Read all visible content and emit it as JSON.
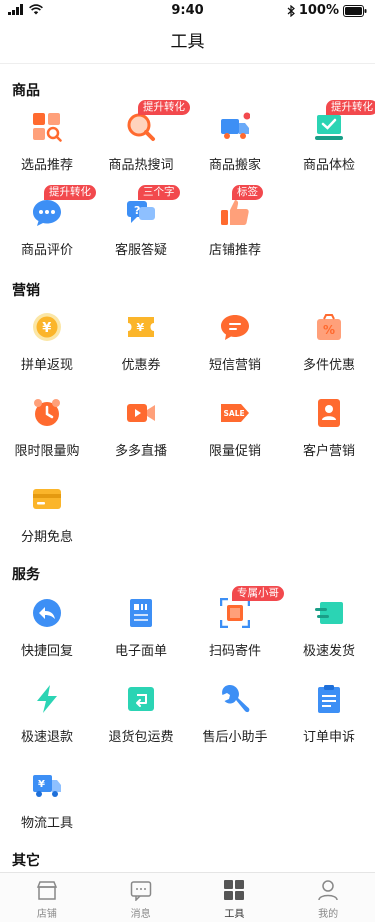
{
  "status_bar": {
    "time": "9:40",
    "battery": "100%"
  },
  "nav": {
    "title": "工具"
  },
  "sections": {
    "goods": {
      "title": "商品",
      "items": [
        {
          "label": "选品推荐"
        },
        {
          "label": "商品热搜词",
          "badge": "提升转化"
        },
        {
          "label": "商品搬家"
        },
        {
          "label": "商品体检",
          "badge": "提升转化"
        },
        {
          "label": "商品评价",
          "badge": "提升转化"
        },
        {
          "label": "客服答疑",
          "badge": "三个字"
        },
        {
          "label": "店铺推荐",
          "badge": "标签"
        }
      ]
    },
    "marketing": {
      "title": "营销",
      "items": [
        {
          "label": "拼单返现"
        },
        {
          "label": "优惠券"
        },
        {
          "label": "短信营销"
        },
        {
          "label": "多件优惠"
        },
        {
          "label": "限时限量购"
        },
        {
          "label": "多多直播"
        },
        {
          "label": "限量促销"
        },
        {
          "label": "客户营销"
        },
        {
          "label": "分期免息"
        }
      ]
    },
    "service": {
      "title": "服务",
      "items": [
        {
          "label": "快捷回复"
        },
        {
          "label": "电子面单"
        },
        {
          "label": "扫码寄件",
          "badge": "专属小哥"
        },
        {
          "label": "极速发货"
        },
        {
          "label": "极速退款"
        },
        {
          "label": "退货包运费"
        },
        {
          "label": "售后小助手"
        },
        {
          "label": "订单申诉"
        },
        {
          "label": "物流工具"
        }
      ]
    },
    "other": {
      "title": "其它"
    }
  },
  "tabbar": {
    "items": [
      {
        "label": "店铺"
      },
      {
        "label": "消息"
      },
      {
        "label": "工具"
      },
      {
        "label": "我的"
      }
    ]
  },
  "colors": {
    "badge": "#f2494d",
    "orange": "#ff6a2f",
    "blue": "#3d8ff5",
    "green": "#2bd4b4",
    "yellow": "#fbb52a"
  }
}
